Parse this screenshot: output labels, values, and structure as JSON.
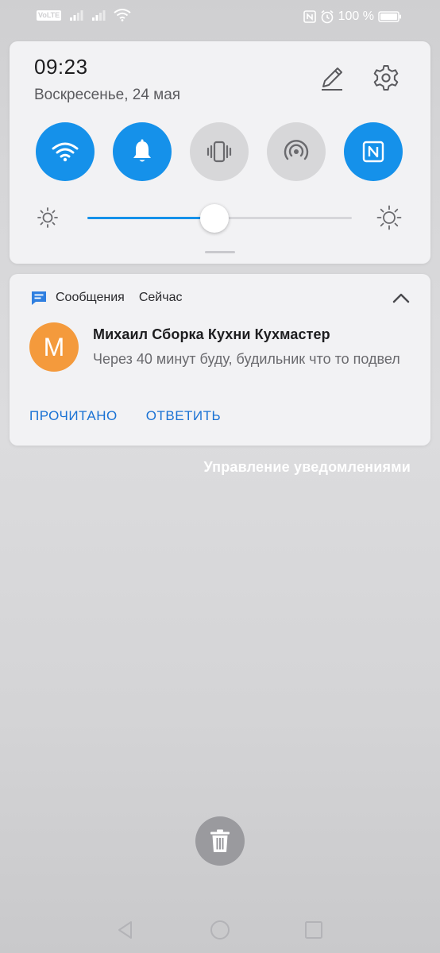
{
  "status_bar": {
    "volte": "VoLTE",
    "battery_text": "100 %"
  },
  "quick_settings": {
    "time": "09:23",
    "date": "Воскресенье, 24 мая",
    "tiles": [
      {
        "name": "wifi",
        "state": "on"
      },
      {
        "name": "sound",
        "state": "on"
      },
      {
        "name": "vibration",
        "state": "off"
      },
      {
        "name": "hotspot",
        "state": "off"
      },
      {
        "name": "nfc",
        "state": "on"
      }
    ],
    "brightness_level": 0.48
  },
  "notification": {
    "app_name": "Сообщения",
    "time": "Сейчас",
    "avatar_letter": "M",
    "title": "Михаил Сборка Кухни Кухмастер",
    "body": "Через 40 минут буду, будильник что то подвел",
    "actions": {
      "read": "ПРОЧИТАНО",
      "reply": "ОТВЕТИТЬ"
    }
  },
  "manage_notifications": "Управление уведомлениями",
  "colors": {
    "accent": "#1591ea",
    "avatar": "#f49a3c",
    "action_text": "#1a72d4"
  }
}
